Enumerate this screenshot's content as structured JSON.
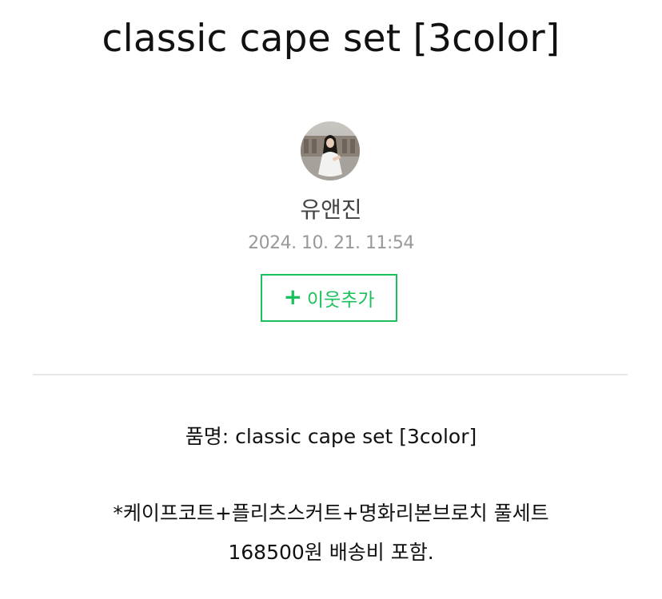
{
  "post": {
    "title": "classic cape set [3color]",
    "author": "유앤진",
    "date": "2024. 10. 21. 11:54",
    "add_neighbor_label": "이웃추가",
    "add_neighbor_icon": "+",
    "body_lines": [
      "품명: classic cape set [3color]",
      "*케이프코트+플리츠스커트+명화리본브로치 풀세트",
      "168500원 배송비 포함."
    ]
  },
  "colors": {
    "accent": "#19c15b",
    "date": "#999999",
    "divider": "#e6e6e6"
  },
  "icons": {
    "add": "plus-icon",
    "profile": "avatar"
  }
}
